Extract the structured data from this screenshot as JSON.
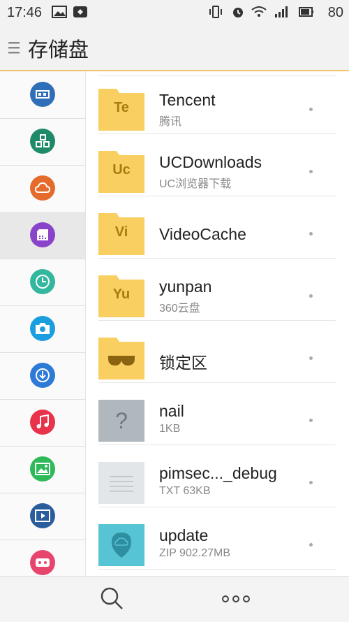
{
  "status_bar": {
    "time": "17:46",
    "battery": "80",
    "network": "3G"
  },
  "header": {
    "title": "存储盘",
    "menu_icon": "hamburger-icon",
    "accent_color": "#f0c36a"
  },
  "sidebar": {
    "items": [
      {
        "icon": "usb-icon",
        "color": "#2f6fb8"
      },
      {
        "icon": "apps-icon",
        "color": "#1f8a6a"
      },
      {
        "icon": "cloud-icon",
        "color": "#e56b2c"
      },
      {
        "icon": "storage-icon",
        "color": "#8a44c9",
        "active": true
      },
      {
        "icon": "clock-icon",
        "color": "#33b79e"
      },
      {
        "icon": "camera-icon",
        "color": "#1a9ee0"
      },
      {
        "icon": "download-icon",
        "color": "#2d7bd6"
      },
      {
        "icon": "music-icon",
        "color": "#e8334a"
      },
      {
        "icon": "image-icon",
        "color": "#2fba5a"
      },
      {
        "icon": "video-icon",
        "color": "#2b5c9c"
      },
      {
        "icon": "game-icon",
        "color": "#e8456e"
      }
    ]
  },
  "files": [
    {
      "name": "Tencent",
      "sub": "腾讯",
      "type": "folder",
      "badge": "Te"
    },
    {
      "name": "UCDownloads",
      "sub": "UC浏览器下载",
      "type": "folder",
      "badge": "Uc"
    },
    {
      "name": "VideoCache",
      "sub": "",
      "type": "folder",
      "badge": "Vi"
    },
    {
      "name": "yunpan",
      "sub": "360云盘",
      "type": "folder",
      "badge": "Yu"
    },
    {
      "name": "锁定区",
      "sub": "",
      "type": "locked-folder",
      "badge": ""
    },
    {
      "name": "nail",
      "sub": "1KB",
      "type": "unknown",
      "badge": "?"
    },
    {
      "name": "pimsec..._debug",
      "sub": "TXT 63KB",
      "type": "text",
      "badge": ""
    },
    {
      "name": "update",
      "sub": "ZIP 902.27MB",
      "type": "zip",
      "badge": ""
    }
  ],
  "bottom_bar": {
    "search_icon": "search-icon",
    "more_icon": "more-horizontal-icon"
  },
  "colors": {
    "folder": "#f9cf62",
    "unknown_file": "#b0b8bd",
    "text_file": "#e2e6e9",
    "zip_file": "#56c4d4"
  }
}
